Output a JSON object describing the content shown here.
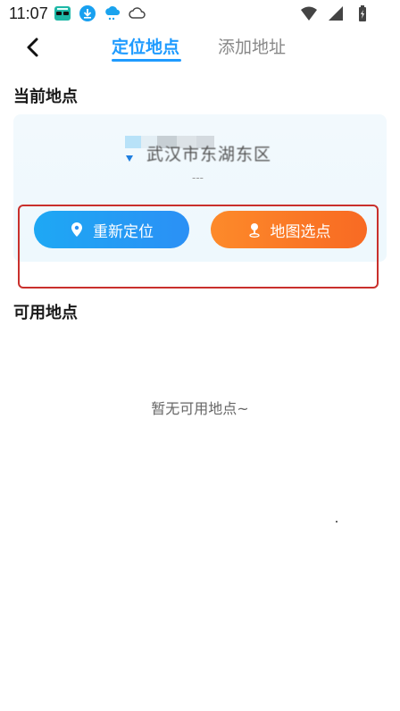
{
  "status_bar": {
    "time": "11:07",
    "left_icons": [
      "sunglasses-app-icon",
      "download-icon",
      "weather-cloud-icon",
      "cloud-outline-icon"
    ],
    "right_icons": [
      "wifi-icon",
      "signal-icon",
      "battery-charging-icon"
    ]
  },
  "nav": {
    "tabs": [
      {
        "label": "定位地点",
        "active": true
      },
      {
        "label": "添加地址",
        "active": false
      }
    ]
  },
  "current_location": {
    "title": "当前地点",
    "address": "武汉市东湖东区",
    "sub": "---",
    "relocate_label": "重新定位",
    "map_pick_label": "地图选点"
  },
  "available": {
    "title": "可用地点",
    "empty_text": "暂无可用地点~"
  },
  "colors": {
    "accent": "#1f9bff",
    "relocate_btn": "#2b90f5",
    "map_btn": "#f86a23",
    "highlight_border": "#c9302c"
  }
}
